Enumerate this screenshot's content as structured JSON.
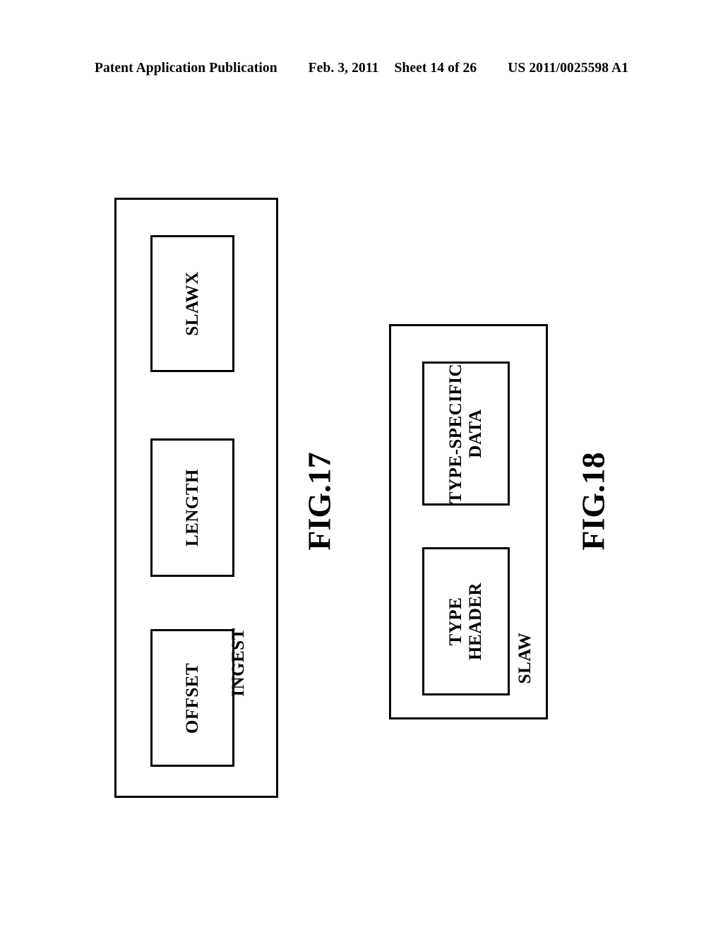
{
  "header": {
    "publication": "Patent Application Publication",
    "date": "Feb. 3, 2011",
    "sheet": "Sheet 14 of 26",
    "patent_number": "US 2011/0025598 A1"
  },
  "figures": [
    {
      "caption": "FIG.17",
      "container_label": "INGEST",
      "blocks": [
        {
          "label": "SLAWX"
        },
        {
          "label": "LENGTH"
        },
        {
          "label": "OFFSET"
        }
      ]
    },
    {
      "caption": "FIG.18",
      "container_label": "SLAW",
      "blocks": [
        {
          "label": "TYPE-SPECIFIC\nDATA"
        },
        {
          "label": "TYPE\nHEADER"
        }
      ]
    }
  ],
  "style": {
    "ink": "#000000",
    "paper": "#ffffff"
  }
}
